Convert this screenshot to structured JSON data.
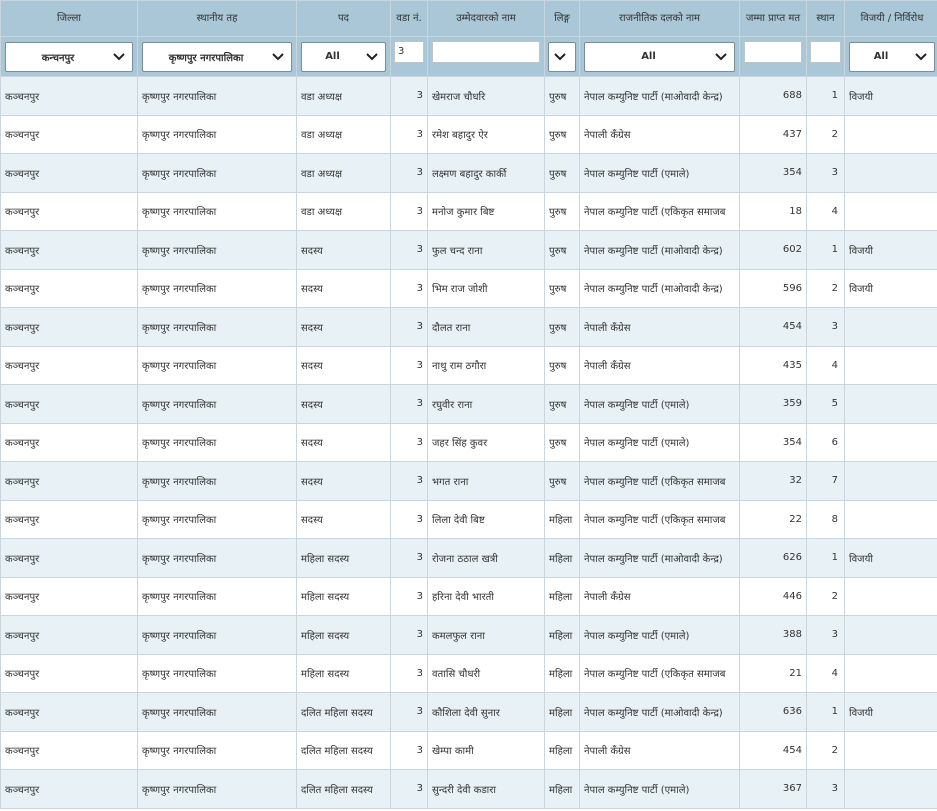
{
  "columns": [
    "जिल्ला",
    "स्थानीय तह",
    "पद",
    "वडा नं.",
    "उम्मेदवारको नाम",
    "लिङ्ग",
    "राजनीतिक दलको नाम",
    "जम्मा प्राप्त मत",
    "स्थान",
    "विजयी / निर्विरोध"
  ],
  "filters": {
    "district": "कन्चनपुर",
    "local_level": "कृष्णपुर नगरपालिका",
    "post": "All",
    "ward": "3",
    "name": "",
    "gender": "",
    "party": "All",
    "votes": "",
    "rank": "",
    "winner": "All"
  },
  "rows": [
    {
      "district": "कञ्चनपुर",
      "local": "कृष्णपुर नगरपालिका",
      "post": "वडा अध्यक्ष",
      "ward": "3",
      "name": "खेमराज चौधरि",
      "gender": "पुरुष",
      "party": "नेपाल कम्युनिष्ट पार्टी (माओवादी केन्द्र)",
      "votes": "688",
      "rank": "1",
      "winner": "विजयी"
    },
    {
      "district": "कञ्चनपुर",
      "local": "कृष्णपुर नगरपालिका",
      "post": "वडा अध्यक्ष",
      "ward": "3",
      "name": "रमेश बहादुर ऐर",
      "gender": "पुरुष",
      "party": "नेपाली कँग्रेस",
      "votes": "437",
      "rank": "2",
      "winner": ""
    },
    {
      "district": "कञ्चनपुर",
      "local": "कृष्णपुर नगरपालिका",
      "post": "वडा अध्यक्ष",
      "ward": "3",
      "name": "लक्ष्मण बहादुर कार्की",
      "gender": "पुरुष",
      "party": "नेपाल कम्युनिष्ट पार्टी (एमाले)",
      "votes": "354",
      "rank": "3",
      "winner": ""
    },
    {
      "district": "कञ्चनपुर",
      "local": "कृष्णपुर नगरपालिका",
      "post": "वडा अध्यक्ष",
      "ward": "3",
      "name": "मनोज कुमार बिष्ट",
      "gender": "पुरुष",
      "party": "नेपाल कम्युनिष्ट पार्टी (एकिकृत समाजब",
      "votes": "18",
      "rank": "4",
      "winner": ""
    },
    {
      "district": "कञ्चनपुर",
      "local": "कृष्णपुर नगरपालिका",
      "post": "सदस्य",
      "ward": "3",
      "name": "फुल चन्द राना",
      "gender": "पुरुष",
      "party": "नेपाल कम्युनिष्ट पार्टी (माओवादी केन्द्र)",
      "votes": "602",
      "rank": "1",
      "winner": "विजयी"
    },
    {
      "district": "कञ्चनपुर",
      "local": "कृष्णपुर नगरपालिका",
      "post": "सदस्य",
      "ward": "3",
      "name": "भिम राज जोशी",
      "gender": "पुरुष",
      "party": "नेपाल कम्युनिष्ट पार्टी (माओवादी केन्द्र)",
      "votes": "596",
      "rank": "2",
      "winner": "विजयी"
    },
    {
      "district": "कञ्चनपुर",
      "local": "कृष्णपुर नगरपालिका",
      "post": "सदस्य",
      "ward": "3",
      "name": "दौलत राना",
      "gender": "पुरुष",
      "party": "नेपाली कँग्रेस",
      "votes": "454",
      "rank": "3",
      "winner": ""
    },
    {
      "district": "कञ्चनपुर",
      "local": "कृष्णपुर नगरपालिका",
      "post": "सदस्य",
      "ward": "3",
      "name": "नाथु राम ठगौरा",
      "gender": "पुरुष",
      "party": "नेपाली कँग्रेस",
      "votes": "435",
      "rank": "4",
      "winner": ""
    },
    {
      "district": "कञ्चनपुर",
      "local": "कृष्णपुर नगरपालिका",
      "post": "सदस्य",
      "ward": "3",
      "name": "रघुवीर राना",
      "gender": "पुरुष",
      "party": "नेपाल कम्युनिष्ट पार्टी (एमाले)",
      "votes": "359",
      "rank": "5",
      "winner": ""
    },
    {
      "district": "कञ्चनपुर",
      "local": "कृष्णपुर नगरपालिका",
      "post": "सदस्य",
      "ward": "3",
      "name": "जहर सिंह कुवर",
      "gender": "पुरुष",
      "party": "नेपाल कम्युनिष्ट पार्टी (एमाले)",
      "votes": "354",
      "rank": "6",
      "winner": ""
    },
    {
      "district": "कञ्चनपुर",
      "local": "कृष्णपुर नगरपालिका",
      "post": "सदस्य",
      "ward": "3",
      "name": "भगत राना",
      "gender": "पुरुष",
      "party": "नेपाल कम्युनिष्ट पार्टी (एकिकृत समाजब",
      "votes": "32",
      "rank": "7",
      "winner": ""
    },
    {
      "district": "कञ्चनपुर",
      "local": "कृष्णपुर नगरपालिका",
      "post": "सदस्य",
      "ward": "3",
      "name": "लिला देवी बिष्ट",
      "gender": "महिला",
      "party": "नेपाल कम्युनिष्ट पार्टी (एकिकृत समाजब",
      "votes": "22",
      "rank": "8",
      "winner": ""
    },
    {
      "district": "कञ्चनपुर",
      "local": "कृष्णपुर नगरपालिका",
      "post": "महिला सदस्य",
      "ward": "3",
      "name": "रोजना ठठाल खत्री",
      "gender": "महिला",
      "party": "नेपाल कम्युनिष्ट पार्टी (माओवादी केन्द्र)",
      "votes": "626",
      "rank": "1",
      "winner": "विजयी"
    },
    {
      "district": "कञ्चनपुर",
      "local": "कृष्णपुर नगरपालिका",
      "post": "महिला सदस्य",
      "ward": "3",
      "name": "हरिना देवी भारती",
      "gender": "महिला",
      "party": "नेपाली कँग्रेस",
      "votes": "446",
      "rank": "2",
      "winner": ""
    },
    {
      "district": "कञ्चनपुर",
      "local": "कृष्णपुर नगरपालिका",
      "post": "महिला सदस्य",
      "ward": "3",
      "name": "कमलफुल राना",
      "gender": "महिला",
      "party": "नेपाल कम्युनिष्ट पार्टी (एमाले)",
      "votes": "388",
      "rank": "3",
      "winner": ""
    },
    {
      "district": "कञ्चनपुर",
      "local": "कृष्णपुर नगरपालिका",
      "post": "महिला सदस्य",
      "ward": "3",
      "name": "वतासि चौधरी",
      "gender": "महिला",
      "party": "नेपाल कम्युनिष्ट पार्टी (एकिकृत समाजब",
      "votes": "21",
      "rank": "4",
      "winner": ""
    },
    {
      "district": "कञ्चनपुर",
      "local": "कृष्णपुर नगरपालिका",
      "post": "दलित महिला सदस्य",
      "ward": "3",
      "name": "कौशिला देवी सुनार",
      "gender": "महिला",
      "party": "नेपाल कम्युनिष्ट पार्टी (माओवादी केन्द्र)",
      "votes": "636",
      "rank": "1",
      "winner": "विजयी"
    },
    {
      "district": "कञ्चनपुर",
      "local": "कृष्णपुर नगरपालिका",
      "post": "दलित महिला सदस्य",
      "ward": "3",
      "name": "खेम्पा कामी",
      "gender": "महिला",
      "party": "नेपाली कँग्रेस",
      "votes": "454",
      "rank": "2",
      "winner": ""
    },
    {
      "district": "कञ्चनपुर",
      "local": "कृष्णपुर नगरपालिका",
      "post": "दलित महिला सदस्य",
      "ward": "3",
      "name": "सुन्दरी देवी कडारा",
      "gender": "महिला",
      "party": "नेपाल कम्युनिष्ट पार्टी (एमाले)",
      "votes": "367",
      "rank": "3",
      "winner": ""
    }
  ]
}
